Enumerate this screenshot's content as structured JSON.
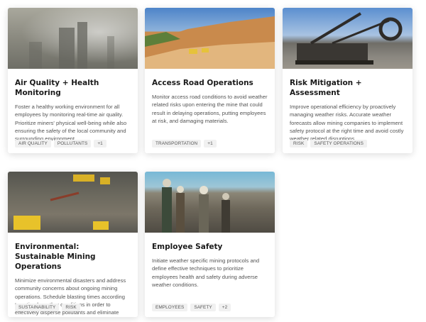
{
  "cards": [
    {
      "title": "Air Quality + Health Monitoring",
      "description": "Foster a healthy working environment for all employees by monitoring real-time air quality. Prioritize miners' physical well-being while also ensuring the safety of the local community and surrounding environment.",
      "tags": [
        "AIR QUALITY",
        "POLLUTANTS",
        "+1"
      ]
    },
    {
      "title": "Access Road Operations",
      "description": "Monitor access road conditions to avoid weather related risks upon entering the mine that could result in delaying operations, putting employees at risk, and damaging materials.",
      "tags": [
        "TRANSPORTATION",
        "+1"
      ]
    },
    {
      "title": "Risk Mitigation + Assessment",
      "description": "Improve operational efficiency by proactively managing weather risks. Accurate weather forecasts allow mining companies to implement safety protocol at the right time and avoid costly weather related disruptions.",
      "tags": [
        "RISK",
        "SAFETY OPERATIONS"
      ]
    },
    {
      "title": "Environmental: Sustainable Mining Operations",
      "description": "Minimize environmental disasters and address community concerns about ongoing mining operations. Schedule blasting times according to optimal weather conditions in order to effectively disperse pollutants and eliminate",
      "tags": [
        "SUSTAINABILITY",
        "RISK"
      ]
    },
    {
      "title": "Employee Safety",
      "description": "Initiate weather specific mining protocols and define effective techniques to prioritize employees health and safety during adverse weather conditions.",
      "tags": [
        "EMPLOYEES",
        "SAFETY",
        "+2"
      ]
    }
  ]
}
